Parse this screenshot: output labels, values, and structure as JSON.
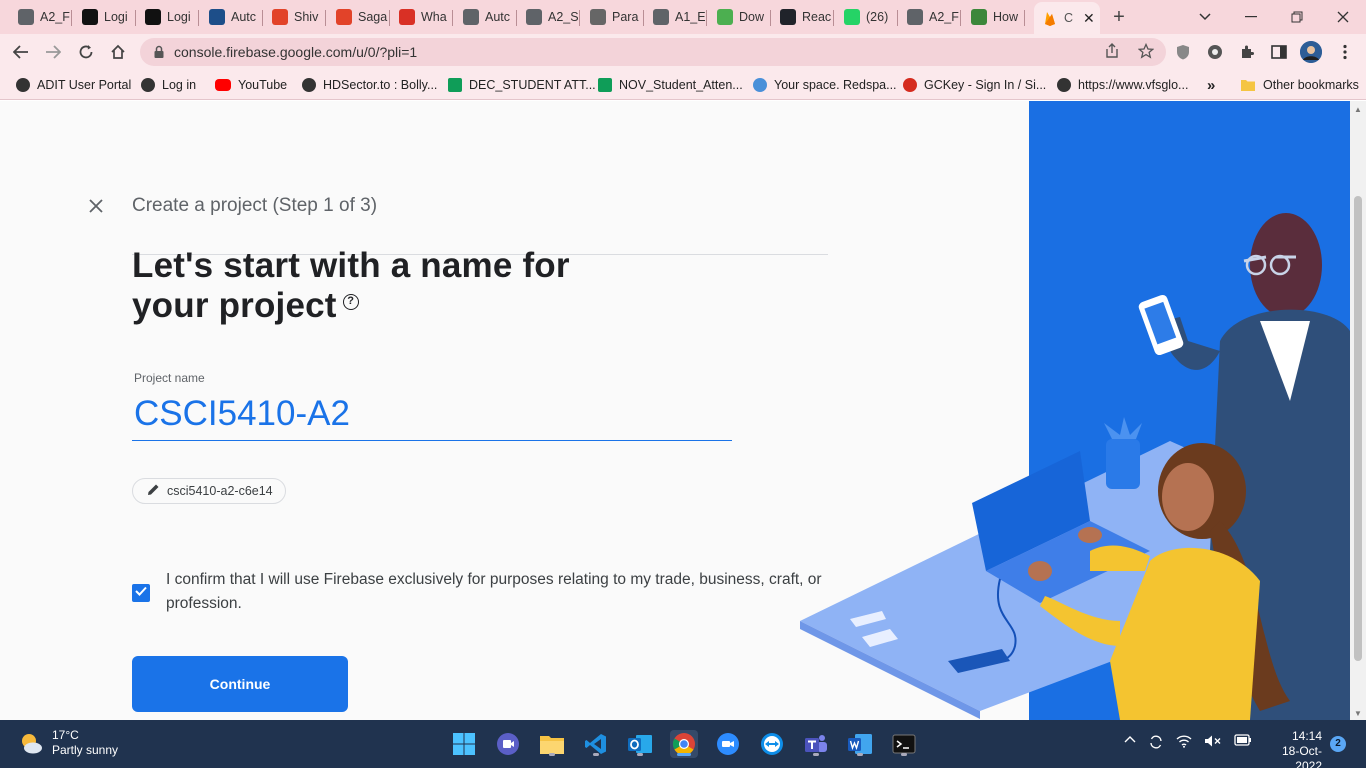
{
  "browser": {
    "tabs": [
      {
        "label": "A2_F",
        "icon": "globe-icon",
        "color": "#5f6368"
      },
      {
        "label": "Logi",
        "icon": "d2l-icon",
        "color": "#111111"
      },
      {
        "label": "Logi",
        "icon": "d2l-icon",
        "color": "#111111"
      },
      {
        "label": "Autc",
        "icon": "ieee-icon",
        "color": "#1d4e89"
      },
      {
        "label": "Shiv",
        "icon": "gitlab-icon",
        "color": "#e24329"
      },
      {
        "label": "Saga",
        "icon": "gitlab-icon",
        "color": "#e24329"
      },
      {
        "label": "Wha",
        "icon": "alert-icon",
        "color": "#d93025"
      },
      {
        "label": "Autc",
        "icon": "globe-icon",
        "color": "#5f6368"
      },
      {
        "label": "A2_S",
        "icon": "globe-icon",
        "color": "#5f6368"
      },
      {
        "label": "Para",
        "icon": "feather-icon",
        "color": "#666666"
      },
      {
        "label": "A1_E",
        "icon": "globe-icon",
        "color": "#5f6368"
      },
      {
        "label": "Dow",
        "icon": "cube-icon",
        "color": "#4caf50"
      },
      {
        "label": "Reac",
        "icon": "react-icon",
        "color": "#20232a"
      },
      {
        "label": "(26)",
        "icon": "whatsapp-icon",
        "color": "#25d366"
      },
      {
        "label": "A2_F",
        "icon": "globe-icon",
        "color": "#5f6368"
      },
      {
        "label": "How",
        "icon": "nodejs-icon",
        "color": "#3c873a"
      }
    ],
    "active_tab": {
      "label": "C",
      "icon": "firebase-icon"
    },
    "new_tab_symbol": "+",
    "url": "console.firebase.google.com/u/0/?pli=1",
    "bookmarks": [
      {
        "label": "ADIT User Portal",
        "icon": "globe-icon"
      },
      {
        "label": "Log in",
        "icon": "globe-icon"
      },
      {
        "label": "YouTube",
        "icon": "youtube-icon"
      },
      {
        "label": "HDSector.to : Bolly...",
        "icon": "globe-icon"
      },
      {
        "label": "DEC_STUDENT ATT...",
        "icon": "sheets-icon"
      },
      {
        "label": "NOV_Student_Atten...",
        "icon": "sheets-icon"
      },
      {
        "label": "Your space. Redspa...",
        "icon": "puzzle-icon"
      },
      {
        "label": "GCKey - Sign In / Si...",
        "icon": "maple-leaf-icon"
      },
      {
        "label": "https://www.vfsglo...",
        "icon": "globe-icon"
      }
    ],
    "bookmarks_overflow": "»",
    "other_bookmarks": "Other bookmarks"
  },
  "dialog": {
    "step_title": "Create a project (Step 1 of 3)",
    "headline_line1": "Let's start with a name for",
    "headline_line2": "your project",
    "help_symbol": "?",
    "project_name_label": "Project name",
    "project_name_value": "CSCI5410-A2",
    "project_id": "csci5410-a2-c6e14",
    "confirm_text": "I confirm that I will use Firebase exclusively for purposes relating to my trade, business, craft, or profession.",
    "confirm_checked": true,
    "continue_label": "Continue"
  },
  "taskbar": {
    "weather_temp": "17°C",
    "weather_desc": "Partly sunny",
    "apps": [
      "start",
      "search-widget",
      "file-explorer",
      "vscode",
      "outlook",
      "chrome",
      "zoom",
      "teamviewer",
      "teams",
      "word",
      "terminal"
    ],
    "time": "14:14",
    "date": "18-Oct-2022",
    "notification_count": "2"
  },
  "colors": {
    "accent": "#1a73e8",
    "tabstrip": "#f7d7dc",
    "taskbar": "#20334f"
  }
}
